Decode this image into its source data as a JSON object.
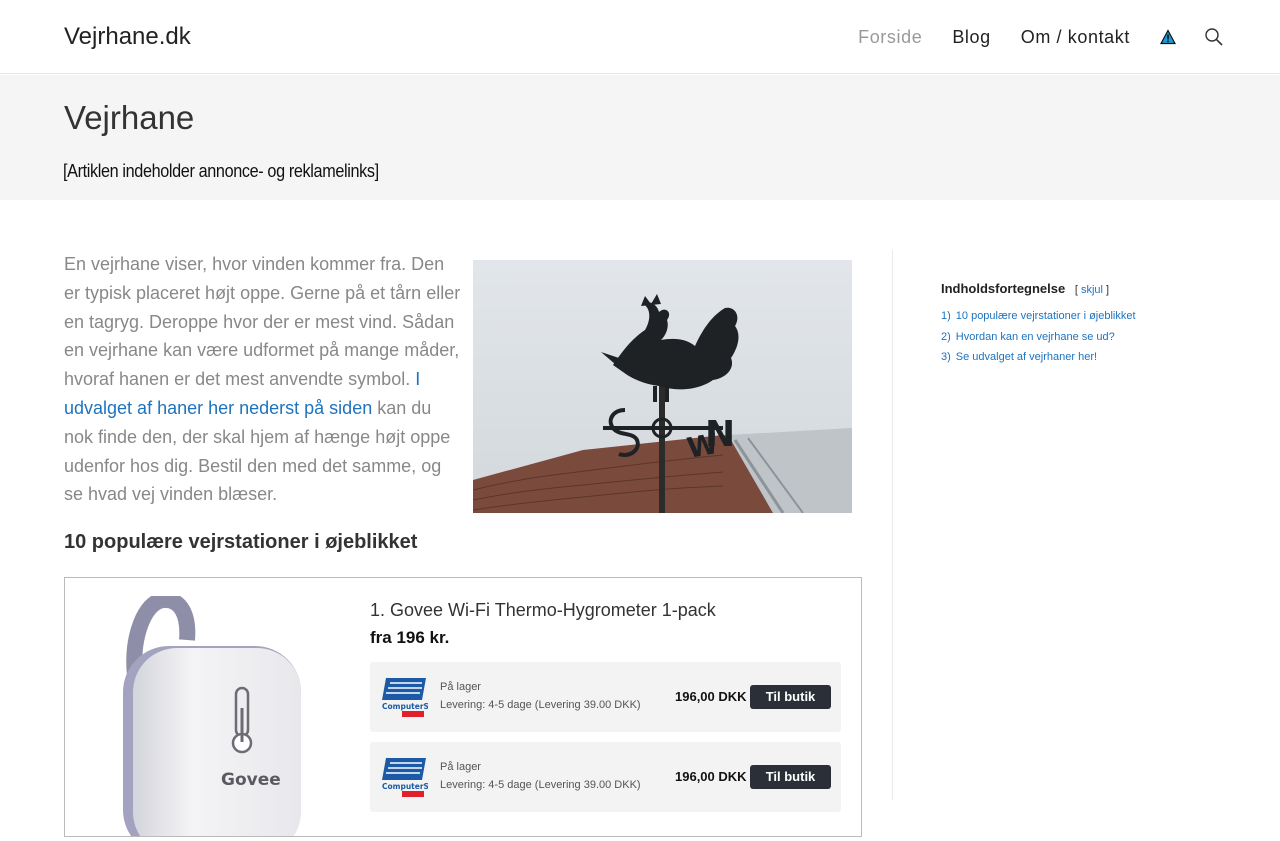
{
  "header": {
    "logo": "Vejrhane.dk",
    "nav": [
      {
        "label": "Forside"
      },
      {
        "label": "Blog"
      },
      {
        "label": "Om / kontakt"
      }
    ]
  },
  "title_band": {
    "title": "Vejrhane",
    "disclaimer": "[Artiklen indeholder annonce- og reklamelinks]"
  },
  "intro": {
    "text_before": "En vejrhane viser, hvor vinden kommer fra. Den er typisk placeret højt oppe. Gerne på et tårn eller en tagryg. Deroppe hvor der er mest vind. Sådan en vejrhane kan være udformet på mange måder, hvoraf hanen er det mest anvendte symbol. ",
    "link_text": "I udvalget af haner her nederst på siden",
    "text_after": " kan du nok finde den, der skal hjem af hænge højt oppe udenfor hos dig. Bestil den med det samme, og se hvad vej vinden blæser.",
    "image_letters": [
      "S",
      "W",
      "N"
    ]
  },
  "section_heading": "10 populære vejrstationer i øjeblikket",
  "product": {
    "name": "1. Govee Wi-Fi Thermo-Hygrometer 1-pack",
    "price": "fra 196 kr.",
    "brand_on_image": "Govee",
    "offers": [
      {
        "stock": "På lager",
        "shipping": "Levering: 4-5 dage (Levering 39.00 DKK)",
        "price": "196,00 DKK",
        "button": "Til butik"
      },
      {
        "stock": "På lager",
        "shipping": "Levering: 4-5 dage (Levering 39.00 DKK)",
        "price": "196,00 DKK",
        "button": "Til butik"
      }
    ]
  },
  "toc": {
    "title": "Indholdsfortegnelse",
    "toggle": "skjul",
    "items": [
      {
        "num": "1)",
        "label": "10 populære vejrstationer i øjeblikket"
      },
      {
        "num": "2)",
        "label": "Hvordan kan en vejrhane se ud?"
      },
      {
        "num": "3)",
        "label": "Se udvalget af vejrhaner her!"
      }
    ]
  },
  "colors": {
    "link": "#1e73be",
    "button": "#2b2f38",
    "title_band": "#f5f5f5"
  }
}
